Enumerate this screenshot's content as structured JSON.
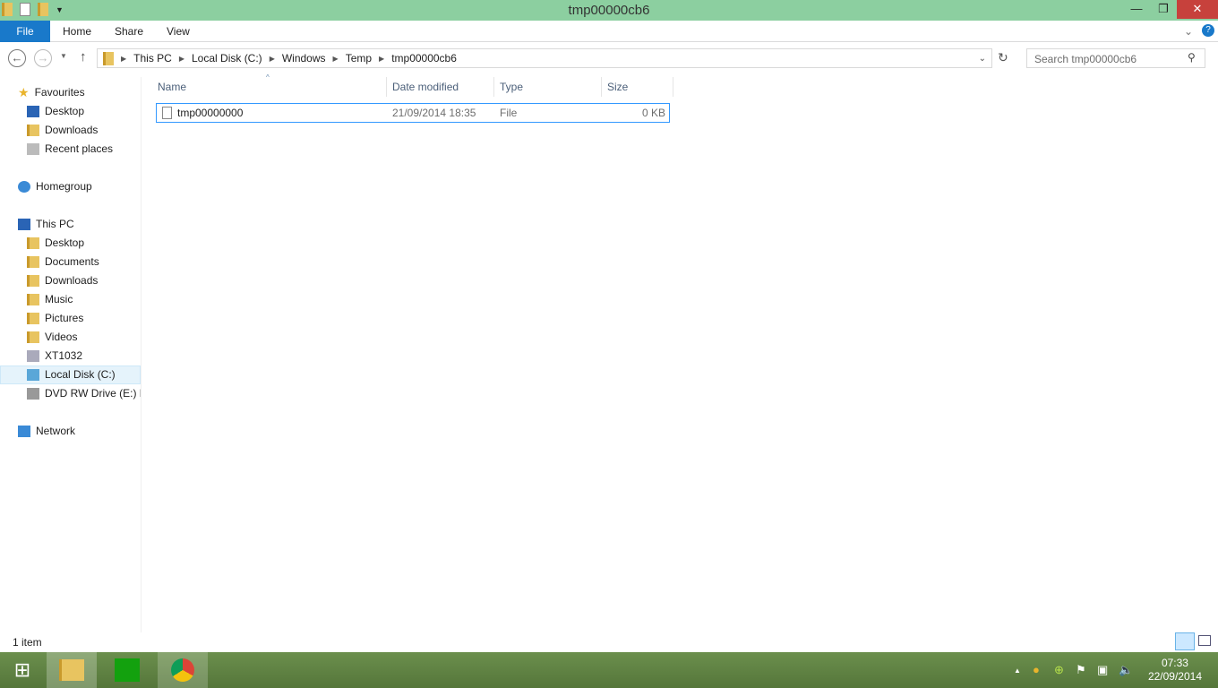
{
  "window": {
    "title": "tmp00000cb6"
  },
  "ribbon": {
    "tabs": [
      "File",
      "Home",
      "Share",
      "View"
    ]
  },
  "address": {
    "crumbs": [
      "This PC",
      "Local Disk (C:)",
      "Windows",
      "Temp",
      "tmp00000cb6"
    ]
  },
  "search": {
    "placeholder": "Search tmp00000cb6"
  },
  "sidebar": {
    "favourites": "Favourites",
    "fav_items": [
      "Desktop",
      "Downloads",
      "Recent places"
    ],
    "homegroup": "Homegroup",
    "thispc": "This PC",
    "pc_items": [
      "Desktop",
      "Documents",
      "Downloads",
      "Music",
      "Pictures",
      "Videos",
      "XT1032",
      "Local Disk (C:)",
      "DVD RW Drive (E:) H"
    ],
    "network": "Network"
  },
  "columns": [
    "Name",
    "Date modified",
    "Type",
    "Size"
  ],
  "files": [
    {
      "name": "tmp00000000",
      "date": "21/09/2014 18:35",
      "type": "File",
      "size": "0 KB"
    }
  ],
  "status": "1 item",
  "clock": {
    "time": "07:33",
    "date": "22/09/2014"
  }
}
